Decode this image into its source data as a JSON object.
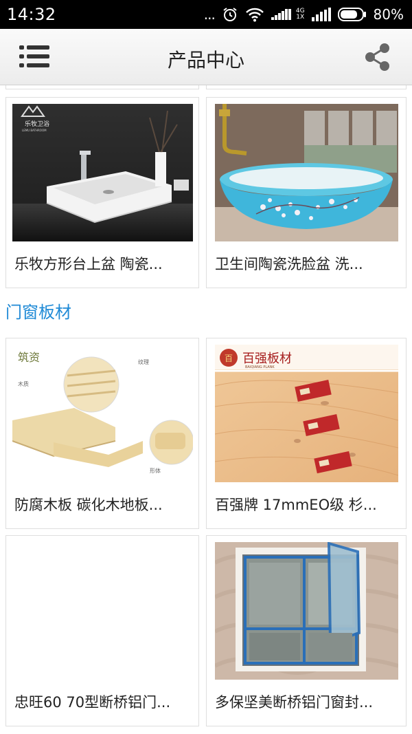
{
  "status_bar": {
    "time": "14:32",
    "dots": "...",
    "network_top": "4G",
    "network_bottom": "1X",
    "battery_percent": "80%",
    "battery_level": 0.8,
    "icons": [
      "alarm-icon",
      "wifi-icon",
      "signal-icon",
      "battery-icon"
    ]
  },
  "header": {
    "title": "产品中心",
    "menu_icon": "menu-list-icon",
    "share_icon": "share-icon"
  },
  "sections": [
    {
      "products": [
        {
          "name": "乐牧方形台上盆 陶瓷...",
          "brand": "乐牧卫浴",
          "brand_sub": "LEMU BATHROOM"
        },
        {
          "name": "卫生间陶瓷洗脸盆 洗..."
        }
      ]
    },
    {
      "title": "门窗板材",
      "products": [
        {
          "name": "防腐木板 碳化木地板...",
          "brand": "筑资",
          "labels": [
            "纹理",
            "木质",
            "形体"
          ]
        },
        {
          "name": "百强牌 17mmEO级 杉...",
          "brand": "百强板材",
          "brand_sub": "BAIQIANG PLANK"
        },
        {
          "name": "忠旺60 70型断桥铝门..."
        },
        {
          "name": "多保坚美断桥铝门窗封..."
        }
      ]
    }
  ],
  "colors": {
    "accent": "#1f8ad6",
    "header_bg": "#f2f2f2",
    "status_bg": "#000000"
  }
}
